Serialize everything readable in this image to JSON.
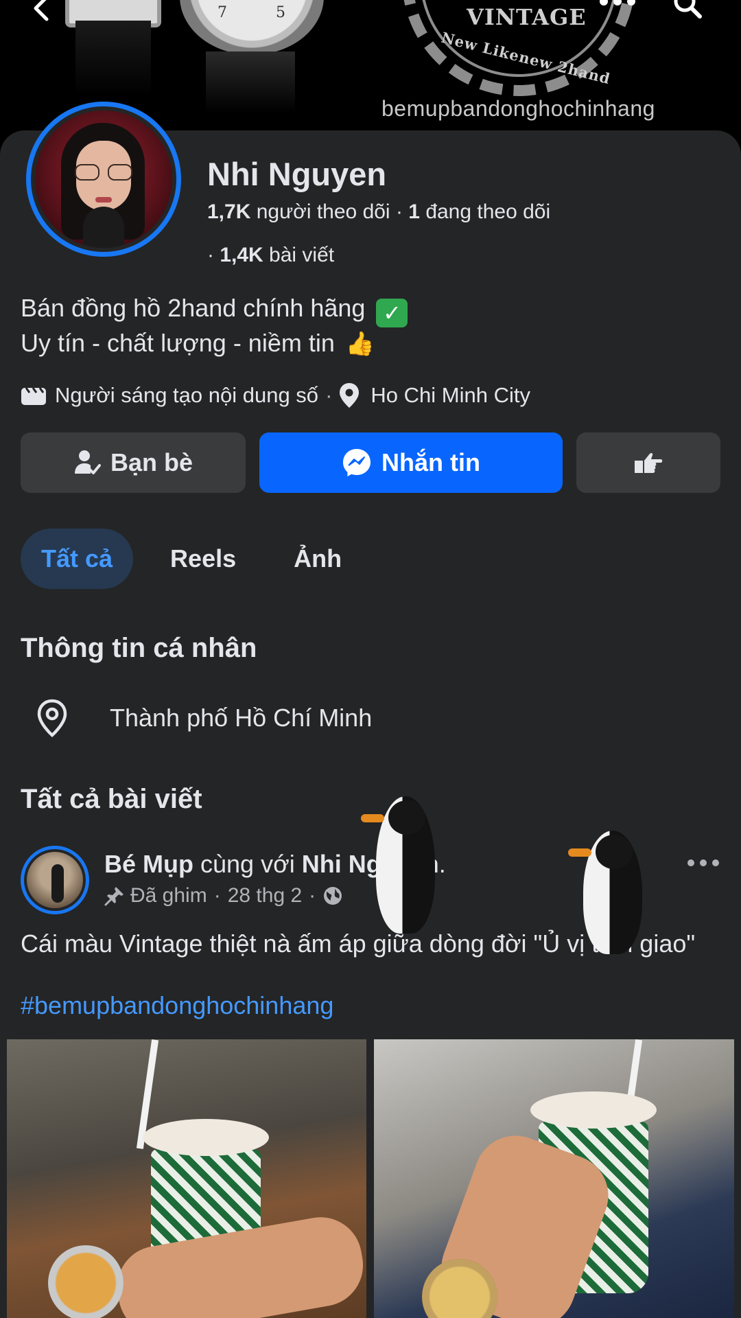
{
  "cover": {
    "brand_title": "VINTAGE",
    "brand_subtitle": "New Likenew 2hand",
    "handle": "bemupbandonghochinhang",
    "watch_numerals": [
      "7",
      "5"
    ]
  },
  "profile": {
    "name": "Nhi Nguyen",
    "followers_count": "1,7K",
    "followers_label": "người theo dõi",
    "following_count": "1",
    "following_label": "đang theo dõi",
    "posts_count": "1,4K",
    "posts_label": "bài viết",
    "bio_line1": "Bán đồng hồ 2hand chính hãng",
    "bio_line1_emoji": "✓",
    "bio_line2": "Uy tín - chất lượng - niềm tin",
    "bio_line2_emoji": "👍",
    "category": "Người sáng tạo nội dung số",
    "location": "Ho Chi Minh City"
  },
  "actions": {
    "friends_label": "Bạn bè",
    "message_label": "Nhắn tin",
    "more_icon": "thumb-point-icon"
  },
  "tabs": [
    {
      "label": "Tất cả",
      "active": true
    },
    {
      "label": "Reels",
      "active": false
    },
    {
      "label": "Ảnh",
      "active": false
    }
  ],
  "personal_info": {
    "title": "Thông tin cá nhân",
    "location": "Thành phố Hồ Chí Minh"
  },
  "posts_section": {
    "title": "Tất cả bài viết"
  },
  "post": {
    "author": "Bé Mụp",
    "with_text": "cùng với",
    "tagged": "Nhi Nguyen",
    "pinned_label": "Đã ghim",
    "date": "28 thg 2",
    "text": "Cái màu Vintage thiệt nà ấm áp giữa dòng đời \"Ủ vị tâm giao\"",
    "hashtag": "#bemupbandonghochinhang"
  },
  "colors": {
    "accent": "#0866ff",
    "avatar_ring": "#1877f2",
    "active_tab_bg": "#263951",
    "active_tab_text": "#4599ff",
    "background": "#242526"
  }
}
